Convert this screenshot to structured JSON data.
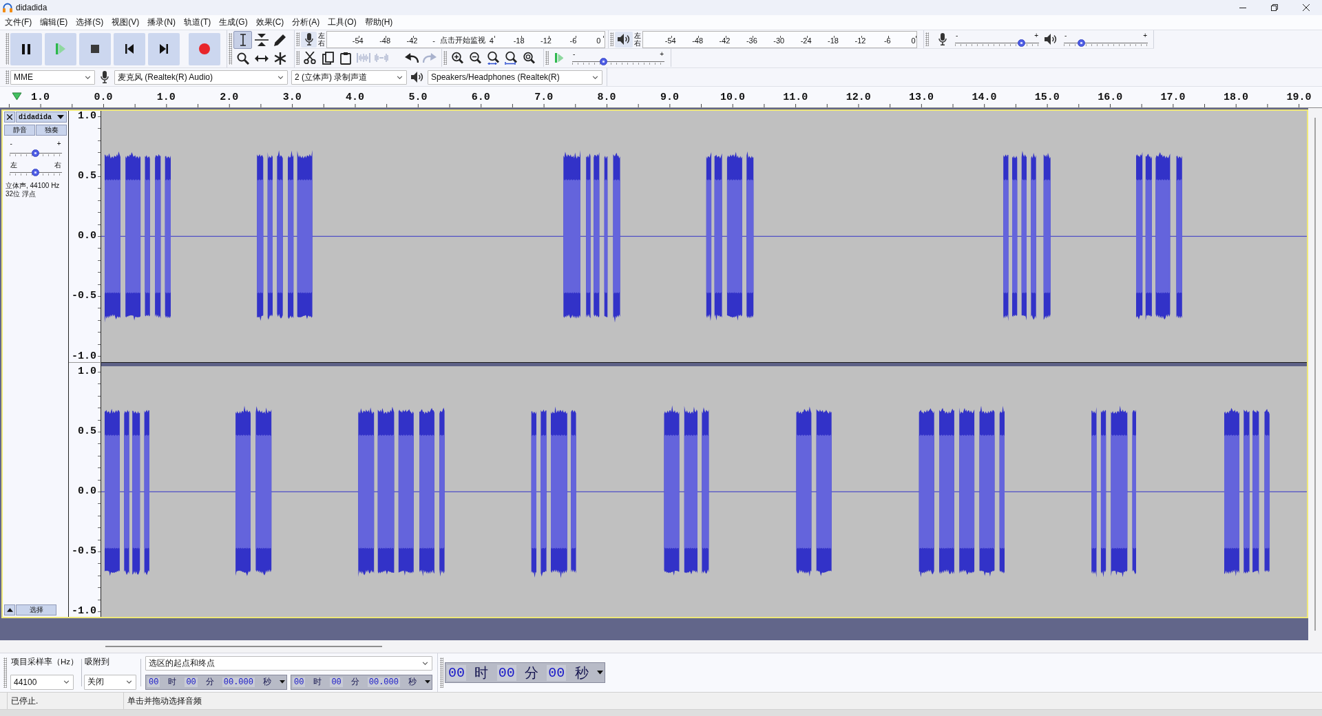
{
  "window": {
    "title": "didadida"
  },
  "menu": [
    "文件(F)",
    "编辑(E)",
    "选择(S)",
    "视图(V)",
    "播录(N)",
    "轨道(T)",
    "生成(G)",
    "效果(C)",
    "分析(A)",
    "工具(O)",
    "帮助(H)"
  ],
  "tools": [
    {
      "kind": "select",
      "selected": true
    },
    {
      "kind": "envelope",
      "selected": false
    },
    {
      "kind": "draw",
      "selected": false
    },
    {
      "kind": "zoom",
      "selected": false
    },
    {
      "kind": "timeshift",
      "selected": false
    },
    {
      "kind": "multi",
      "selected": false
    }
  ],
  "recording_meter": {
    "channel_labels": [
      "左",
      "右"
    ],
    "scale_before": [
      "-54",
      "-48",
      "-42",
      "-"
    ],
    "prompt": "点击开始监视",
    "scale_after": [
      "4",
      "-18",
      "-12",
      "-6",
      "0"
    ]
  },
  "playback_meter": {
    "channel_labels": [
      "左",
      "右"
    ],
    "scale": [
      "-54",
      "-48",
      "-42",
      "-36",
      "-30",
      "-24",
      "-18",
      "-12",
      "-6",
      "0"
    ]
  },
  "mixer": {
    "recording_volume": {
      "min_label": "-",
      "max_label": "+",
      "level": 0.79
    },
    "playback_volume": {
      "min_label": "-",
      "max_label": "+",
      "level": 0.21
    }
  },
  "edit_buttons": [
    {
      "kind": "cut",
      "disabled": false
    },
    {
      "kind": "copy",
      "disabled": false
    },
    {
      "kind": "paste",
      "disabled": false
    },
    {
      "kind": "trim",
      "disabled": true
    },
    {
      "kind": "silence",
      "disabled": true
    },
    {
      "kind": "undo",
      "disabled": false
    },
    {
      "kind": "redo",
      "disabled": true
    }
  ],
  "play_at_speed": {
    "min_label": "-",
    "max_label": "+",
    "level": 0.34
  },
  "devices": {
    "host": "MME",
    "input": "麦克风 (Realtek(R) Audio)",
    "channels": "2 (立体声) 录制声道",
    "output": "Speakers/Headphones (Realtek(R)"
  },
  "timeline": {
    "labels": [
      "1.0",
      "0.0",
      "1.0",
      "2.0",
      "3.0",
      "4.0",
      "5.0",
      "6.0",
      "7.0",
      "8.0",
      "9.0",
      "10.0",
      "11.0",
      "12.0",
      "13.0",
      "14.0",
      "15.0",
      "16.0",
      "17.0",
      "18.0",
      "19.0"
    ]
  },
  "track": {
    "focused": true,
    "name": "didadida",
    "mute": "静音",
    "solo": "独奏",
    "gain": {
      "min_label": "-",
      "max_label": "+",
      "level": 0.5
    },
    "pan": {
      "min_label": "左",
      "max_label": "右",
      "level": 0.5
    },
    "info": [
      "立体声, 44100 Hz",
      "32位 浮点"
    ],
    "select_button": "选择",
    "channels": [
      {
        "ruler": [
          "1.0",
          "0.5",
          "0.0",
          "-0.5",
          "-1.0"
        ]
      },
      {
        "ruler": [
          "1.0",
          "0.5",
          "0.0",
          "-0.5",
          "-1.0"
        ]
      }
    ]
  },
  "selection_toolbar": {
    "rate_label": "项目采样率（Hz）",
    "snap_label": "吸附到",
    "rate": "44100",
    "snap": "关闭",
    "mode": "选区的起点和终点",
    "start": [
      "00",
      "时",
      "00",
      "分",
      "00.000",
      "秒"
    ],
    "end": [
      "00",
      "时",
      "00",
      "分",
      "00.000",
      "秒"
    ]
  },
  "time_display": [
    "00",
    "时",
    "00",
    "分",
    "00",
    "秒"
  ],
  "status_bar": {
    "state": "已停止.",
    "hint": "单击并拖动选择音频"
  }
}
